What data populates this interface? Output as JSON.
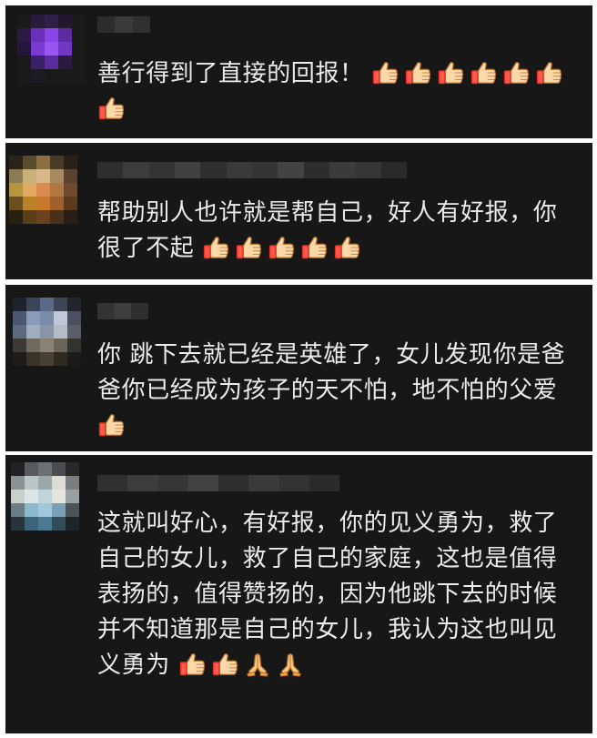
{
  "comments": [
    {
      "text": "善行得到了直接的回报！",
      "reactions": [
        "thumbs-up",
        "thumbs-up",
        "thumbs-up",
        "thumbs-up",
        "thumbs-up",
        "thumbs-up",
        "thumbs-up"
      ],
      "avatar_colors": [
        "#1a1a1a",
        "#2a1a3c",
        "#2f1d4a",
        "#231730",
        "#1a1a1a",
        "#2c1a44",
        "#6a2fb8",
        "#8c44e6",
        "#5d2aa0",
        "#1a1a1a",
        "#24153a",
        "#7a3bd0",
        "#9a55f0",
        "#7036c4",
        "#1a1a1a",
        "#1a1a1a",
        "#3c2066",
        "#5a2b9a",
        "#2a1a40",
        "#1a1a1a",
        "#1a1a1a",
        "#1c1a22",
        "#1a1a1a",
        "#1a1a1a",
        "#1a1a1a"
      ]
    },
    {
      "text": "帮助别人也许就是帮自己，好人有好报，你很了不起",
      "reactions": [
        "thumbs-up",
        "thumbs-up",
        "thumbs-up",
        "thumbs-up",
        "thumbs-up"
      ],
      "avatar_colors": [
        "#2a2418",
        "#5a4a30",
        "#8a7040",
        "#4a3a28",
        "#2a2018",
        "#8c7c54",
        "#c8b07a",
        "#d8b888",
        "#a88a60",
        "#5a4230",
        "#b89440",
        "#e0a860",
        "#d88a50",
        "#b07840",
        "#704a30",
        "#6a5020",
        "#b8822a",
        "#c8782a",
        "#a0602a",
        "#5a3a20",
        "#2a2010",
        "#5a3e1c",
        "#6a4220",
        "#4a3018",
        "#2a1e14"
      ]
    },
    {
      "text": "你 跳下去就已经是英雄了，女儿发现你是爸爸你已经成为孩子的天不怕，地不怕的父爱",
      "reactions": [
        "thumbs-up"
      ],
      "avatar_colors": [
        "#1e222a",
        "#3a4658",
        "#5a6a84",
        "#3c4456",
        "#22252c",
        "#4a5872",
        "#8a9ab8",
        "#7a8caa",
        "#c0c8d8",
        "#4a5060",
        "#5c6a80",
        "#a0acc0",
        "#8894a8",
        "#b4bcc8",
        "#5a5e68",
        "#3c3a36",
        "#706a5c",
        "#8a8270",
        "#6a6456",
        "#34322e",
        "#1e1c1a",
        "#3a3428",
        "#4a4030",
        "#302a22",
        "#1c1b1a"
      ]
    },
    {
      "text": "这就叫好心，有好报，你的见义勇为，救了自己的女儿，救了自己的家庭，这也是值得表扬的，值得赞扬的，因为他跳下去的时候并不知道那是自己的女儿，我认为这也叫见义勇为",
      "reactions": [
        "thumbs-up",
        "thumbs-up",
        "folded-hands",
        "folded-hands"
      ],
      "avatar_colors": [
        "#202224",
        "#585c5e",
        "#6c7274",
        "#4a4e50",
        "#262829",
        "#8a9294",
        "#b8c6c8",
        "#9aa8aa",
        "#dcdcd4",
        "#7a7e80",
        "#c8d0cc",
        "#dce4e8",
        "#c0d4dc",
        "#e4e4dc",
        "#9aa0a2",
        "#6a7e88",
        "#8cb8cc",
        "#a0c8dc",
        "#78a0b4",
        "#4a5458",
        "#28343a",
        "#3a6478",
        "#4a7a90",
        "#344c58",
        "#1e2428"
      ]
    }
  ]
}
